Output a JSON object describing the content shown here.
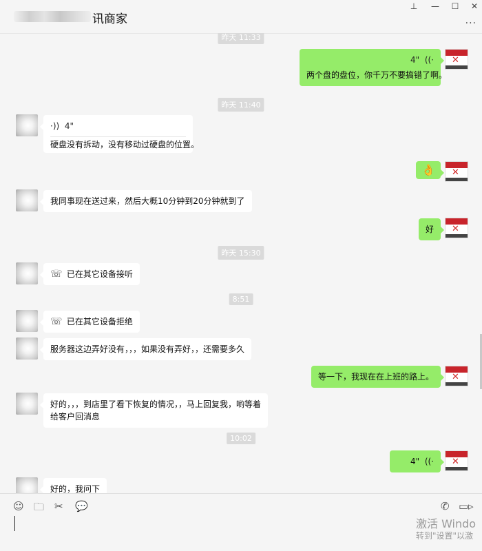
{
  "window": {
    "title_visible": "讯商家",
    "pin_icon": "pin-icon",
    "minimize_icon": "minimize-icon",
    "maximize_icon": "maximize-icon",
    "close_icon": "close-icon",
    "more_icon": "more-icon"
  },
  "chat": {
    "timestamps": [
      "昨天 11:33",
      "昨天 11:40",
      "昨天 15:30",
      "8:51",
      "10:02"
    ],
    "messages": [
      {
        "side": "out",
        "voice": "4\"",
        "text": "两个盘的盘位，你千万不要搞错了啊。"
      },
      {
        "side": "in",
        "voice": "4\"",
        "text": "硬盘没有拆动，没有移动过硬盘的位置。"
      },
      {
        "side": "out",
        "emoji": "👌"
      },
      {
        "side": "in",
        "text": "我同事现在送过来，然后大概10分钟到20分钟就到了"
      },
      {
        "side": "out",
        "text": "好"
      },
      {
        "side": "in",
        "call": "已在其它设备接听"
      },
      {
        "side": "in",
        "call": "已在其它设备拒绝"
      },
      {
        "side": "in",
        "text": "服务器这边弄好没有，，，如果没有弄好，，还需要多久"
      },
      {
        "side": "out",
        "text": "等一下，我现在在上班的路上。"
      },
      {
        "side": "in",
        "lines": [
          "好的，，，到店里了看下恢复的情况，，马上回复我，哟等着",
          "给客户回消息"
        ]
      },
      {
        "side": "out",
        "voice": "4\""
      },
      {
        "side": "in",
        "text": "好的，我问下"
      }
    ]
  },
  "toolbar": {
    "icons": [
      "emoji-icon",
      "folder-icon",
      "scissors-icon",
      "chat-bubble-icon",
      "phone-icon",
      "video-icon"
    ]
  },
  "watermark": {
    "line1": "激活 Windo",
    "line2": "转到\"设置\"以激"
  },
  "colors": {
    "outgoing": "#95ec69",
    "incoming": "#ffffff",
    "background": "#f5f5f5"
  }
}
